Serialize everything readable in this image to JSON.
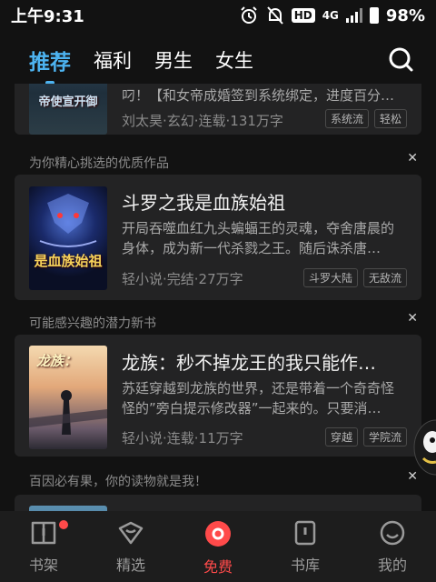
{
  "status_bar": {
    "time": "上午9:31",
    "hd": "HD",
    "network": "4G",
    "battery": "98%"
  },
  "top_nav": {
    "tabs": [
      {
        "label": "推荐"
      },
      {
        "label": "福利"
      },
      {
        "label": "男生"
      },
      {
        "label": "女生"
      }
    ],
    "accent": "#4db3f0"
  },
  "feed": {
    "partial_card": {
      "desc": "叼！【和女帝成婚签到系统绑定，进度百分…",
      "meta": "刘太昊·玄幻·连载·131万字",
      "tags": [
        "系统流",
        "轻松"
      ],
      "cover_text": "帝使宣开御"
    },
    "sections": [
      {
        "label": "为你精心挑选的优质作品",
        "title": "斗罗之我是血族始祖",
        "desc": "开局吞噬血红九头蝙蝠王的灵魂，夺舍唐晨的身体，成为新一代杀戮之王。随后诛杀唐…",
        "meta": "轻小说·完结·27万字",
        "tags": [
          "斗罗大陆",
          "无敌流"
        ],
        "cover_text": "是血族始祖"
      },
      {
        "label": "可能感兴趣的潜力新书",
        "title": "龙族：秒不掉龙王的我只能作…",
        "desc": "苏廷穿越到龙族的世界，还是带着一个奇奇怪怪的”旁白提示修改器”一起来的。只要消…",
        "meta": "轻小说·连载·11万字",
        "tags": [
          "穿越",
          "学院流"
        ],
        "cover_text": "龙族："
      },
      {
        "label": "百因必有果，你的读物就是我！"
      }
    ]
  },
  "bottom_nav": {
    "items": [
      {
        "label": "书架"
      },
      {
        "label": "精选"
      },
      {
        "label": "免费"
      },
      {
        "label": "书库"
      },
      {
        "label": "我的"
      }
    ],
    "active_color": "#ff4a4a"
  }
}
